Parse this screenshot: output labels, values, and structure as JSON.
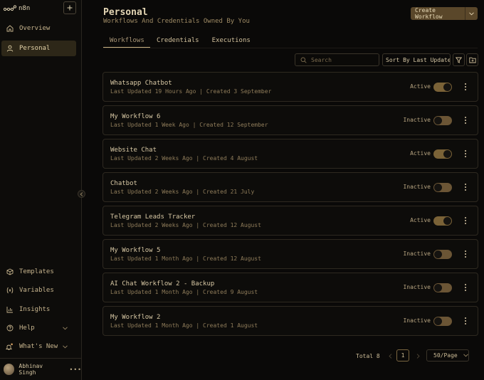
{
  "app": {
    "name": "n8n"
  },
  "sidebar": {
    "items": [
      {
        "label": "Overview",
        "icon": "home-icon"
      },
      {
        "label": "Personal",
        "icon": "user-icon"
      }
    ],
    "bottom_items": [
      {
        "label": "Templates",
        "icon": "box-icon"
      },
      {
        "label": "Variables",
        "icon": "variable-icon"
      },
      {
        "label": "Insights",
        "icon": "chart-icon"
      },
      {
        "label": "Help",
        "icon": "help-icon"
      },
      {
        "label": "What's New",
        "icon": "bell-icon"
      }
    ],
    "user": {
      "name": "Abhinav Singh"
    }
  },
  "header": {
    "title": "Personal",
    "subtitle": "Workflows And Credentials Owned By You",
    "create_label": "Create Workflow"
  },
  "tabs": [
    {
      "label": "Workflows"
    },
    {
      "label": "Credentials"
    },
    {
      "label": "Executions"
    }
  ],
  "toolbar": {
    "search_placeholder": "Search",
    "sort_label": "Sort By Last Updated"
  },
  "workflows": [
    {
      "name": "Whatsapp Chatbot",
      "meta": "Last Updated 19 Hours Ago | Created 3 September",
      "status": "Active",
      "active": true
    },
    {
      "name": "My Workflow 6",
      "meta": "Last Updated 1 Week Ago | Created 12 September",
      "status": "Inactive",
      "active": false
    },
    {
      "name": "Website Chat",
      "meta": "Last Updated 2 Weeks Ago | Created 4 August",
      "status": "Active",
      "active": true
    },
    {
      "name": "Chatbot",
      "meta": "Last Updated 2 Weeks Ago | Created 21 July",
      "status": "Inactive",
      "active": false
    },
    {
      "name": "Telegram Leads Tracker",
      "meta": "Last Updated 2 Weeks Ago | Created 12 August",
      "status": "Active",
      "active": true
    },
    {
      "name": "My Workflow 5",
      "meta": "Last Updated 1 Month Ago | Created 12 August",
      "status": "Inactive",
      "active": false
    },
    {
      "name": "AI Chat Workflow 2 - Backup",
      "meta": "Last Updated 1 Month Ago | Created 9 August",
      "status": "Inactive",
      "active": false
    },
    {
      "name": "My Workflow 2",
      "meta": "Last Updated 1 Month Ago | Created 1 August",
      "status": "Inactive",
      "active": false
    }
  ],
  "pagination": {
    "total_label": "Total 8",
    "current_page": "1",
    "per_page": "50/Page"
  }
}
